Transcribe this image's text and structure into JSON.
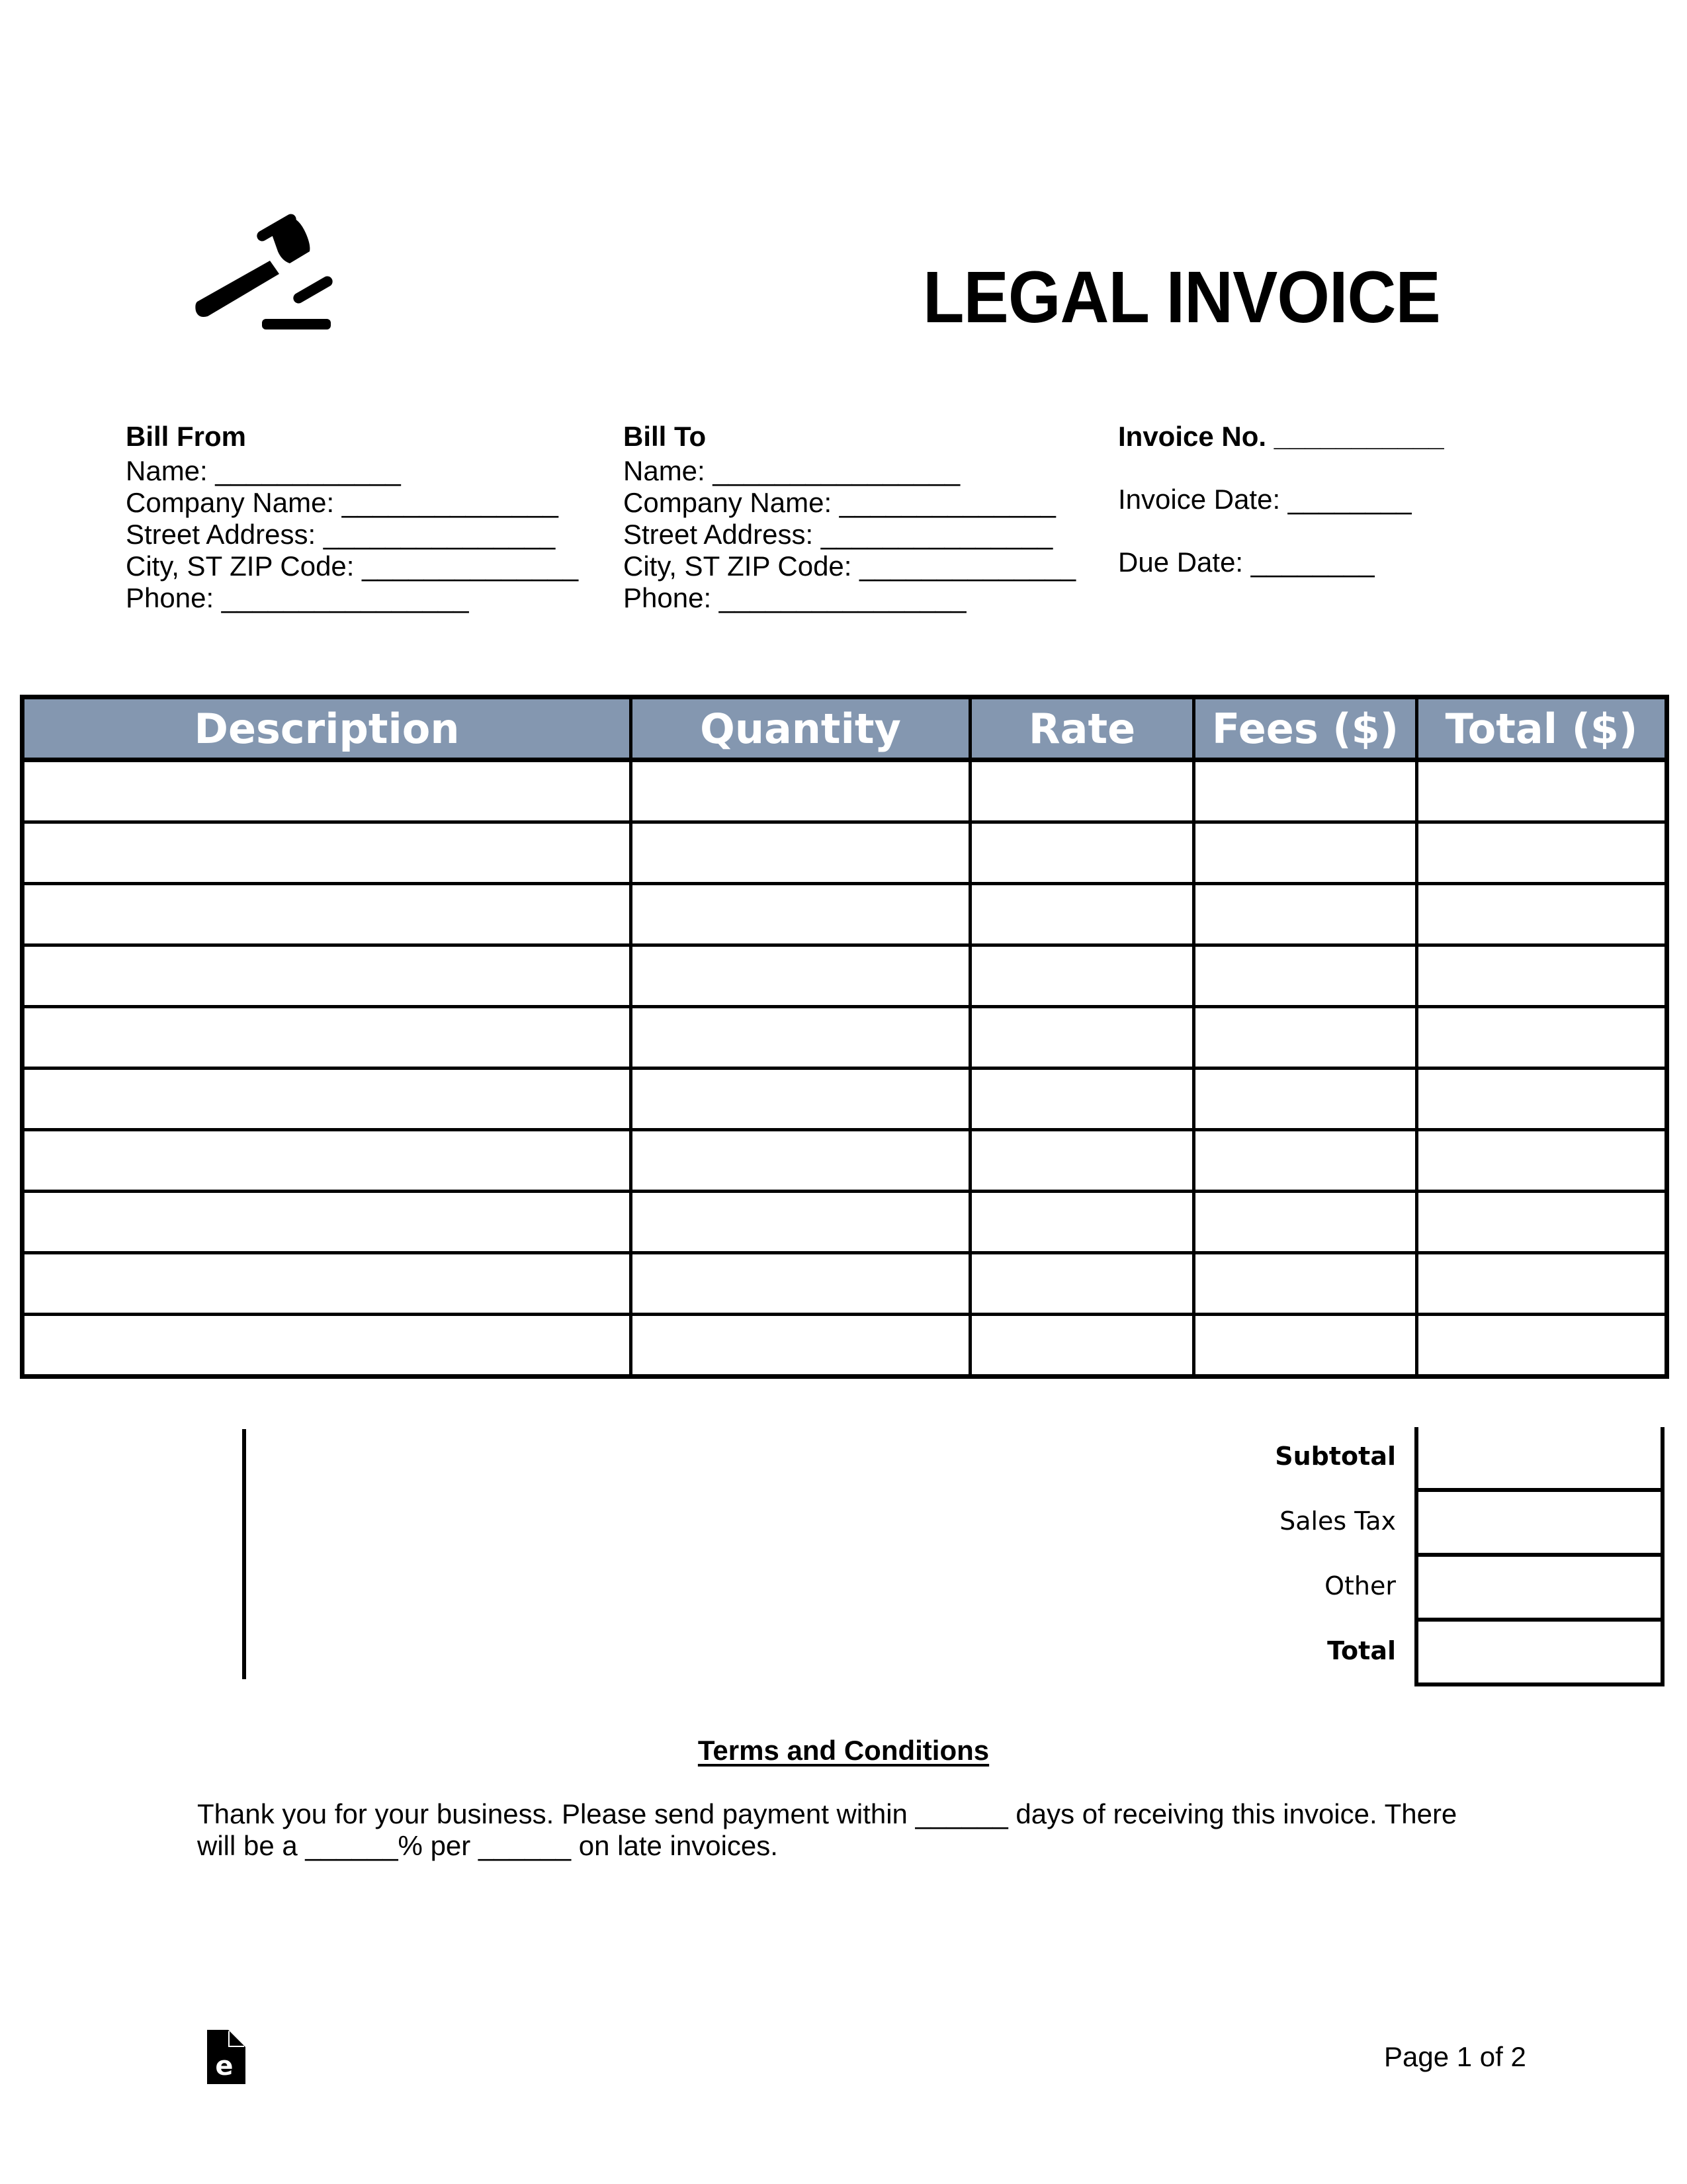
{
  "document": {
    "title": "LEGAL INVOICE",
    "logo_icon": "gavel-icon",
    "footer_icon": "document-e-icon",
    "page_indicator": "Page 1 of 2"
  },
  "bill_from": {
    "heading": "Bill From",
    "lines": [
      "Name: ____________",
      "Company Name: ______________",
      "Street Address: _______________",
      "City, ST ZIP Code: ______________",
      "Phone: ________________"
    ]
  },
  "bill_to": {
    "heading": "Bill To",
    "lines": [
      "Name: ________________",
      "Company Name: ______________",
      "Street Address: _______________",
      "City, ST ZIP Code: ______________",
      "Phone: ________________"
    ]
  },
  "invoice_meta": {
    "invoice_no": "Invoice No. ___________",
    "invoice_date": "Invoice Date: ________",
    "due_date": "Due Date: ________"
  },
  "table": {
    "header_color": "#8497b0",
    "columns": [
      "Description",
      "Quantity",
      "Rate",
      "Fees ($)",
      "Total ($)"
    ],
    "rows": [
      [
        "",
        "",
        "",
        "",
        ""
      ],
      [
        "",
        "",
        "",
        "",
        ""
      ],
      [
        "",
        "",
        "",
        "",
        ""
      ],
      [
        "",
        "",
        "",
        "",
        ""
      ],
      [
        "",
        "",
        "",
        "",
        ""
      ],
      [
        "",
        "",
        "",
        "",
        ""
      ],
      [
        "",
        "",
        "",
        "",
        ""
      ],
      [
        "",
        "",
        "",
        "",
        ""
      ],
      [
        "",
        "",
        "",
        "",
        ""
      ],
      [
        "",
        "",
        "",
        "",
        ""
      ]
    ]
  },
  "totals": [
    {
      "label": "Subtotal",
      "value": "",
      "bold": true
    },
    {
      "label": "Sales Tax",
      "value": "",
      "bold": false
    },
    {
      "label": "Other",
      "value": "",
      "bold": false
    },
    {
      "label": "Total",
      "value": "",
      "bold": true
    }
  ],
  "terms": {
    "heading": "Terms and Conditions",
    "text": "Thank you for your business. Please send payment within ______ days of receiving this invoice. There will be a ______% per ______ on late invoices."
  }
}
